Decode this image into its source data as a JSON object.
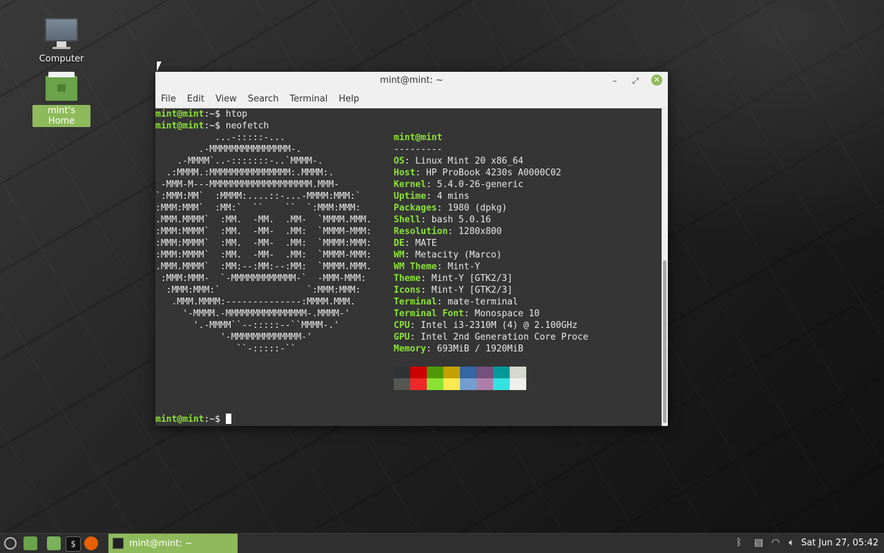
{
  "desktop": {
    "icons": [
      {
        "label": "Computer",
        "icon": "computer-icon"
      },
      {
        "label": "mint's Home",
        "icon": "home-folder-icon"
      }
    ]
  },
  "window": {
    "title": "mint@mint: ~",
    "controls": {
      "minimize": "–",
      "maximize": "⤢",
      "close": "✕"
    },
    "menu": [
      "File",
      "Edit",
      "View",
      "Search",
      "Terminal",
      "Help"
    ]
  },
  "terminal": {
    "prompt_user": "mint@mint",
    "prompt_path": ":~$",
    "commands": [
      "htop",
      "neofetch"
    ],
    "ascii_art": [
      "           ...-:::::-...",
      "        .-MMMMMMMMMMMMMMM-.",
      "    .-MMMM`..-:::::::-..`MMMM-.",
      "  .:MMMM.:MMMMMMMMMMMMMMM:.MMMM:.",
      " -MMM-M---MMMMMMMMMMMMMMMMMMM.MMM-",
      "`:MMM:MM`  :MMMM:....::-...-MMMM:MMM:`",
      ":MMM:MMM`  :MM:`  ``    ``  `:MMM:MMM:",
      ".MMM.MMMM`  :MM.  -MM.  .MM-  `MMMM.MMM.",
      ":MMM:MMMM`  :MM.  -MM-  .MM:  `MMMM-MMM:",
      ":MMM:MMMM`  :MM.  -MM-  .MM:  `MMMM:MMM:",
      ":MMM:MMMM`  :MM.  -MM-  .MM:  `MMMM-MMM:",
      ".MMM.MMMM`  :MM:--:MM:--:MM:  `MMMM.MMM.",
      " :MMM:MMM-  `-MMMMMMMMMMMM-`  -MMM-MMM:",
      "  :MMM:MMM:`                `:MMM:MMM:",
      "   .MMM.MMMM:--------------:MMMM.MMM.",
      "     '-MMMM.-MMMMMMMMMMMMMMM-.MMMM-'",
      "       '.-MMMM``--:::::--``MMMM-.'",
      "            '-MMMMMMMMMMMMM-'",
      "               ``-:::::-``"
    ],
    "info_header": "mint@mint",
    "info_separator": "---------",
    "info": [
      {
        "key": "OS",
        "value": "Linux Mint 20 x86_64"
      },
      {
        "key": "Host",
        "value": "HP ProBook 4230s A0000C02"
      },
      {
        "key": "Kernel",
        "value": "5.4.0-26-generic"
      },
      {
        "key": "Uptime",
        "value": "4 mins"
      },
      {
        "key": "Packages",
        "value": "1980 (dpkg)"
      },
      {
        "key": "Shell",
        "value": "bash 5.0.16"
      },
      {
        "key": "Resolution",
        "value": "1280x800"
      },
      {
        "key": "DE",
        "value": "MATE"
      },
      {
        "key": "WM",
        "value": "Metacity (Marco)"
      },
      {
        "key": "WM Theme",
        "value": "Mint-Y"
      },
      {
        "key": "Theme",
        "value": "Mint-Y [GTK2/3]"
      },
      {
        "key": "Icons",
        "value": "Mint-Y [GTK2/3]"
      },
      {
        "key": "Terminal",
        "value": "mate-terminal"
      },
      {
        "key": "Terminal Font",
        "value": "Monospace 10"
      },
      {
        "key": "CPU",
        "value": "Intel i3-2310M (4) @ 2.100GHz"
      },
      {
        "key": "GPU",
        "value": "Intel 2nd Generation Core Proce"
      },
      {
        "key": "Memory",
        "value": "693MiB / 1920MiB"
      }
    ],
    "palette": {
      "normal": [
        "#2e3436",
        "#cc0000",
        "#4e9a06",
        "#c4a000",
        "#3465a4",
        "#75507b",
        "#06989a",
        "#d3d7cf"
      ],
      "bright": [
        "#555753",
        "#ef2929",
        "#8ae234",
        "#fce94f",
        "#729fcf",
        "#ad7fa8",
        "#34e2e2",
        "#eeeeec"
      ]
    }
  },
  "taskbar": {
    "launchers": [
      "mint-menu-icon",
      "show-desktop-icon",
      "files-icon",
      "terminal-icon",
      "firefox-icon"
    ],
    "task": {
      "label": "mint@mint: ~",
      "icon": "terminal-icon"
    },
    "tray": [
      "bluetooth-icon",
      "clipboard-icon",
      "wifi-icon",
      "volume-icon"
    ],
    "clock": "Sat Jun 27, 05:42"
  },
  "colors": {
    "accent": "#8fba5b",
    "prompt_green": "#8ae234",
    "terminal_bg": "#353535"
  }
}
